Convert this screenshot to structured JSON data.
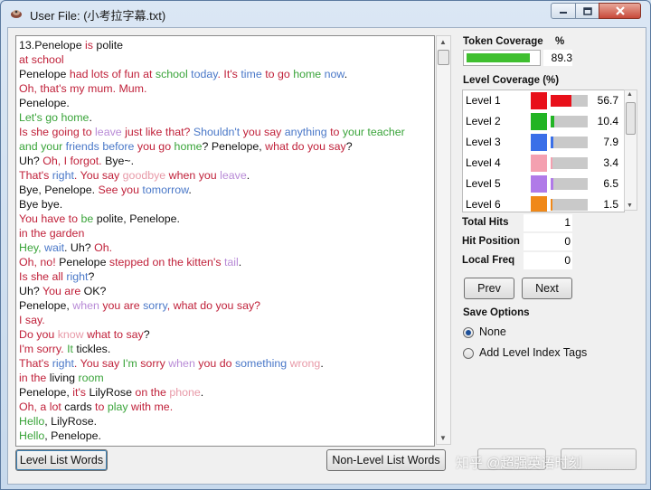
{
  "window": {
    "title": "User File: (小考拉字幕.txt)",
    "colors": {
      "titlebar": "#cfe0f1",
      "close": "#c8493a"
    }
  },
  "text_lines": [
    [
      {
        "t": "13.Penelope ",
        "c": "#111"
      },
      {
        "t": "is",
        "c": "#c0213a"
      },
      {
        "t": " polite",
        "c": "#111"
      }
    ],
    [
      {
        "t": "at school",
        "c": "#c0213a"
      }
    ],
    [
      {
        "t": "Penelope ",
        "c": "#111"
      },
      {
        "t": "had lots of fun at ",
        "c": "#c0213a"
      },
      {
        "t": "school ",
        "c": "#3aa43a"
      },
      {
        "t": "today",
        "c": "#4a78c8"
      },
      {
        "t": ". It's ",
        "c": "#c0213a"
      },
      {
        "t": "time ",
        "c": "#4a78c8"
      },
      {
        "t": "to go ",
        "c": "#c0213a"
      },
      {
        "t": "home ",
        "c": "#3aa43a"
      },
      {
        "t": "now",
        "c": "#4a78c8"
      },
      {
        "t": ".",
        "c": "#111"
      }
    ],
    [
      {
        "t": "Oh, that's my mum. Mum.",
        "c": "#c0213a"
      }
    ],
    [
      {
        "t": "Penelope.",
        "c": "#111"
      }
    ],
    [
      {
        "t": "Let's go ",
        "c": "#3aa43a"
      },
      {
        "t": "home",
        "c": "#3aa43a"
      },
      {
        "t": ".",
        "c": "#111"
      }
    ],
    [
      {
        "t": "Is she going to ",
        "c": "#c0213a"
      },
      {
        "t": "leave ",
        "c": "#b88ad6"
      },
      {
        "t": "just like that? ",
        "c": "#c0213a"
      },
      {
        "t": "Shouldn't ",
        "c": "#4a78c8"
      },
      {
        "t": "you say ",
        "c": "#c0213a"
      },
      {
        "t": "anything ",
        "c": "#4a78c8"
      },
      {
        "t": "to ",
        "c": "#c0213a"
      },
      {
        "t": "your teacher",
        "c": "#3aa43a"
      }
    ],
    [
      {
        "t": "and your ",
        "c": "#3aa43a"
      },
      {
        "t": "friends ",
        "c": "#4a78c8"
      },
      {
        "t": "before ",
        "c": "#4a78c8"
      },
      {
        "t": "you go ",
        "c": "#c0213a"
      },
      {
        "t": "home",
        "c": "#3aa43a"
      },
      {
        "t": "? Penelope, ",
        "c": "#111"
      },
      {
        "t": "what do you say",
        "c": "#c0213a"
      },
      {
        "t": "?",
        "c": "#111"
      }
    ],
    [
      {
        "t": "Uh? ",
        "c": "#111"
      },
      {
        "t": "Oh, I forgot. ",
        "c": "#c0213a"
      },
      {
        "t": "Bye~.",
        "c": "#111"
      }
    ],
    [
      {
        "t": "That's ",
        "c": "#c0213a"
      },
      {
        "t": "right",
        "c": "#4a78c8"
      },
      {
        "t": ". You say ",
        "c": "#c0213a"
      },
      {
        "t": "goodbye ",
        "c": "#e89aa8"
      },
      {
        "t": "when you ",
        "c": "#c0213a"
      },
      {
        "t": "leave",
        "c": "#b88ad6"
      },
      {
        "t": ".",
        "c": "#111"
      }
    ],
    [
      {
        "t": "Bye, Penelope. ",
        "c": "#111"
      },
      {
        "t": "See you ",
        "c": "#c0213a"
      },
      {
        "t": "tomorrow",
        "c": "#4a78c8"
      },
      {
        "t": ".",
        "c": "#111"
      }
    ],
    [
      {
        "t": "Bye bye.",
        "c": "#111"
      }
    ],
    [
      {
        "t": "You have to ",
        "c": "#c0213a"
      },
      {
        "t": "be ",
        "c": "#3aa43a"
      },
      {
        "t": "polite, Penelope.",
        "c": "#111"
      }
    ],
    [
      {
        "t": "in the garden",
        "c": "#c0213a"
      }
    ],
    [
      {
        "t": "Hey, ",
        "c": "#3aa43a"
      },
      {
        "t": "wait",
        "c": "#4a78c8"
      },
      {
        "t": ". Uh? ",
        "c": "#111"
      },
      {
        "t": "Oh.",
        "c": "#c0213a"
      }
    ],
    [
      {
        "t": "Oh, no! ",
        "c": "#c0213a"
      },
      {
        "t": "Penelope ",
        "c": "#111"
      },
      {
        "t": "stepped on the kitten's ",
        "c": "#c0213a"
      },
      {
        "t": "tail",
        "c": "#b88ad6"
      },
      {
        "t": ".",
        "c": "#111"
      }
    ],
    [
      {
        "t": "Is she all ",
        "c": "#c0213a"
      },
      {
        "t": "right",
        "c": "#4a78c8"
      },
      {
        "t": "?",
        "c": "#111"
      }
    ],
    [
      {
        "t": "Uh? ",
        "c": "#111"
      },
      {
        "t": "You are ",
        "c": "#c0213a"
      },
      {
        "t": "OK?",
        "c": "#111"
      }
    ],
    [
      {
        "t": "Penelope, ",
        "c": "#111"
      },
      {
        "t": "when ",
        "c": "#b88ad6"
      },
      {
        "t": "you are ",
        "c": "#c0213a"
      },
      {
        "t": "sorry",
        "c": "#4a78c8"
      },
      {
        "t": ", what do you say?",
        "c": "#c0213a"
      }
    ],
    [
      {
        "t": "I say.",
        "c": "#c0213a"
      }
    ],
    [
      {
        "t": "Do you ",
        "c": "#c0213a"
      },
      {
        "t": "know ",
        "c": "#e89aa8"
      },
      {
        "t": "what to say",
        "c": "#c0213a"
      },
      {
        "t": "?",
        "c": "#111"
      }
    ],
    [
      {
        "t": "I'm sorry. ",
        "c": "#c0213a"
      },
      {
        "t": "It ",
        "c": "#3aa43a"
      },
      {
        "t": "tickles.",
        "c": "#111"
      }
    ],
    [
      {
        "t": "That's ",
        "c": "#c0213a"
      },
      {
        "t": "right",
        "c": "#4a78c8"
      },
      {
        "t": ". You say ",
        "c": "#c0213a"
      },
      {
        "t": "I'm ",
        "c": "#3aa43a"
      },
      {
        "t": "sorry ",
        "c": "#c0213a"
      },
      {
        "t": "when ",
        "c": "#b88ad6"
      },
      {
        "t": "you do ",
        "c": "#c0213a"
      },
      {
        "t": "something ",
        "c": "#4a78c8"
      },
      {
        "t": "wrong",
        "c": "#e89aa8"
      },
      {
        "t": ".",
        "c": "#111"
      }
    ],
    [
      {
        "t": "in the ",
        "c": "#c0213a"
      },
      {
        "t": "living ",
        "c": "#111"
      },
      {
        "t": "room",
        "c": "#3aa43a"
      }
    ],
    [
      {
        "t": "Penelope, ",
        "c": "#111"
      },
      {
        "t": "it's ",
        "c": "#c0213a"
      },
      {
        "t": "LilyRose ",
        "c": "#111"
      },
      {
        "t": "on the ",
        "c": "#c0213a"
      },
      {
        "t": "phone",
        "c": "#e89aa8"
      },
      {
        "t": ".",
        "c": "#111"
      }
    ],
    [
      {
        "t": "Oh, a lot ",
        "c": "#c0213a"
      },
      {
        "t": "cards ",
        "c": "#111"
      },
      {
        "t": "to ",
        "c": "#c0213a"
      },
      {
        "t": "play ",
        "c": "#3aa43a"
      },
      {
        "t": "with me.",
        "c": "#c0213a"
      }
    ],
    [
      {
        "t": "Hello",
        "c": "#3aa43a"
      },
      {
        "t": ", LilyRose.",
        "c": "#111"
      }
    ],
    [
      {
        "t": "Hello",
        "c": "#3aa43a"
      },
      {
        "t": ", Penelope.",
        "c": "#111"
      }
    ]
  ],
  "buttons": {
    "level_list": "Level List Words",
    "non_level_list": "Non-Level List Words",
    "prev": "Prev",
    "next": "Next"
  },
  "token_coverage": {
    "label": "Token Coverage",
    "unit": "%",
    "value": "89.3",
    "fraction": 0.893
  },
  "level_coverage": {
    "label": "Level Coverage (%)",
    "levels": [
      {
        "name": "Level 1",
        "value": "56.7",
        "fraction": 0.567,
        "color": "#e8101a"
      },
      {
        "name": "Level 2",
        "value": "10.4",
        "fraction": 0.104,
        "color": "#22b424"
      },
      {
        "name": "Level 3",
        "value": "7.9",
        "fraction": 0.079,
        "color": "#3a6fe8"
      },
      {
        "name": "Level 4",
        "value": "3.4",
        "fraction": 0.034,
        "color": "#f4a0b0"
      },
      {
        "name": "Level 5",
        "value": "6.5",
        "fraction": 0.065,
        "color": "#b07ae8"
      },
      {
        "name": "Level 6",
        "value": "1.5",
        "fraction": 0.015,
        "color": "#f08818"
      }
    ]
  },
  "stats": {
    "total_hits_label": "Total Hits",
    "total_hits": "1",
    "hit_position_label": "Hit Position",
    "hit_position": "0",
    "local_freq_label": "Local Freq",
    "local_freq": "0"
  },
  "save_options": {
    "label": "Save Options",
    "none": "None",
    "add_tags": "Add Level Index Tags",
    "selected": "None"
  },
  "watermark": "知乎 @超强英语时刻"
}
